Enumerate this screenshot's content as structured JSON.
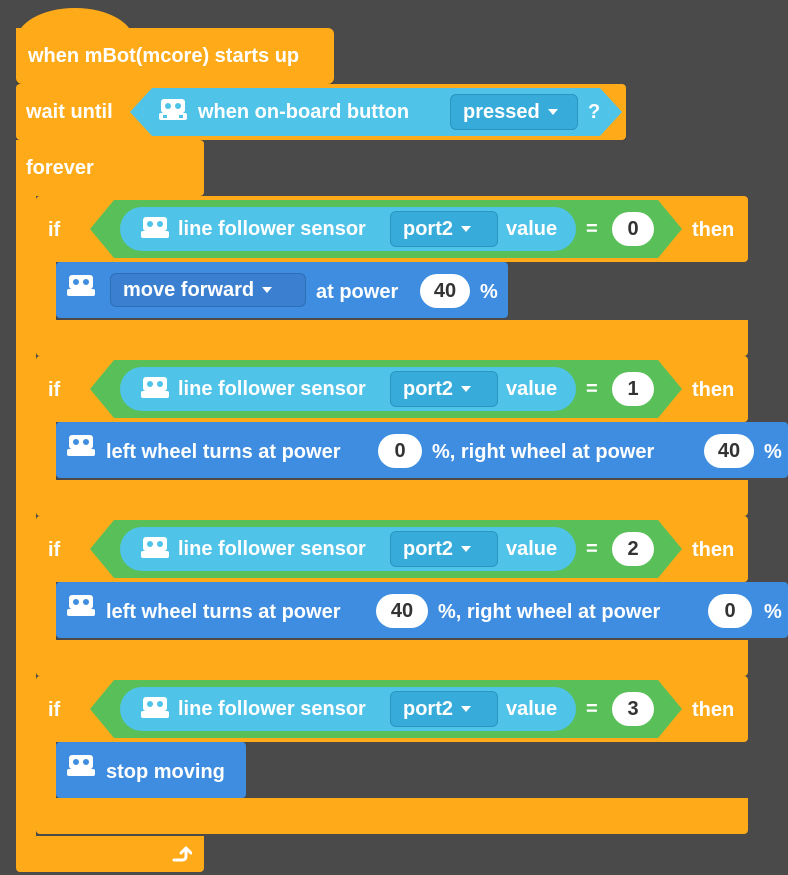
{
  "hat": {
    "label": "when mBot(mcore) starts up"
  },
  "wait": {
    "label": "wait until",
    "condition": {
      "label": "when on-board button",
      "option": "pressed",
      "suffix": "?"
    }
  },
  "forever": {
    "label": "forever",
    "loop_arrow": "loop-arrow-icon"
  },
  "if_blocks": [
    {
      "if_label": "if",
      "sensor_label": "line follower sensor",
      "port": "port2",
      "value_label": "value",
      "op": "=",
      "compare_value": "0",
      "then_label": "then",
      "action": {
        "type": "move",
        "direction": "move forward",
        "at_power": "at power",
        "power": "40",
        "unit": "%"
      }
    },
    {
      "if_label": "if",
      "sensor_label": "line follower sensor",
      "port": "port2",
      "value_label": "value",
      "op": "=",
      "compare_value": "1",
      "then_label": "then",
      "action": {
        "type": "wheels",
        "left_label": "left wheel turns at power",
        "left_power": "0",
        "mid_label": "%,  right wheel at power",
        "right_power": "40",
        "unit": "%"
      }
    },
    {
      "if_label": "if",
      "sensor_label": "line follower sensor",
      "port": "port2",
      "value_label": "value",
      "op": "=",
      "compare_value": "2",
      "then_label": "then",
      "action": {
        "type": "wheels",
        "left_label": "left wheel turns at power",
        "left_power": "40",
        "mid_label": "%,  right wheel at power",
        "right_power": "0",
        "unit": "%"
      }
    },
    {
      "if_label": "if",
      "sensor_label": "line follower sensor",
      "port": "port2",
      "value_label": "value",
      "op": "=",
      "compare_value": "3",
      "then_label": "then",
      "action": {
        "type": "stop",
        "label": "stop moving"
      }
    }
  ],
  "colors": {
    "event_yellow": "#ffab19",
    "sensor_cyan": "#4fc3e8",
    "operator_green": "#59c059",
    "motion_blue": "#3f8de0",
    "background": "#4a4a4a"
  }
}
